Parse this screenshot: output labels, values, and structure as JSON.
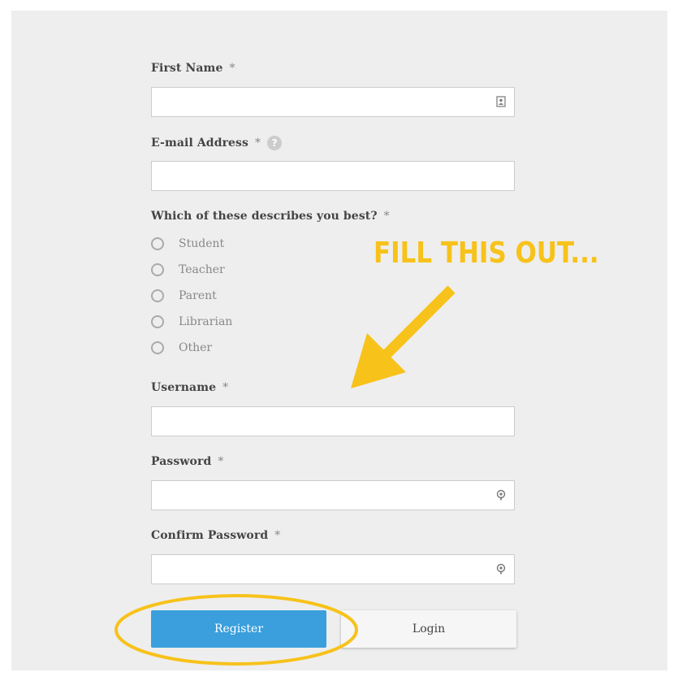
{
  "form": {
    "first_name": {
      "label": "First Name",
      "required": "*",
      "value": "",
      "icon": "contact-card-icon"
    },
    "email": {
      "label": "E-mail Address",
      "required": "*",
      "help": "?",
      "value": ""
    },
    "role": {
      "label": "Which of these describes you best?",
      "required": "*",
      "options": [
        "Student",
        "Teacher",
        "Parent",
        "Librarian",
        "Other"
      ]
    },
    "username": {
      "label": "Username",
      "required": "*",
      "value": ""
    },
    "password": {
      "label": "Password",
      "required": "*",
      "value": "",
      "icon": "password-key-icon"
    },
    "confirm_password": {
      "label": "Confirm Password",
      "required": "*",
      "value": "",
      "icon": "password-key-icon"
    },
    "register_label": "Register",
    "login_label": "Login"
  },
  "annotation": {
    "text": "FILL THIS OUT...",
    "color": "#f7c21a"
  },
  "colors": {
    "panel": "#eeeeee",
    "register_button": "#3a9fdc",
    "accent_annotation": "#f7c21a"
  }
}
